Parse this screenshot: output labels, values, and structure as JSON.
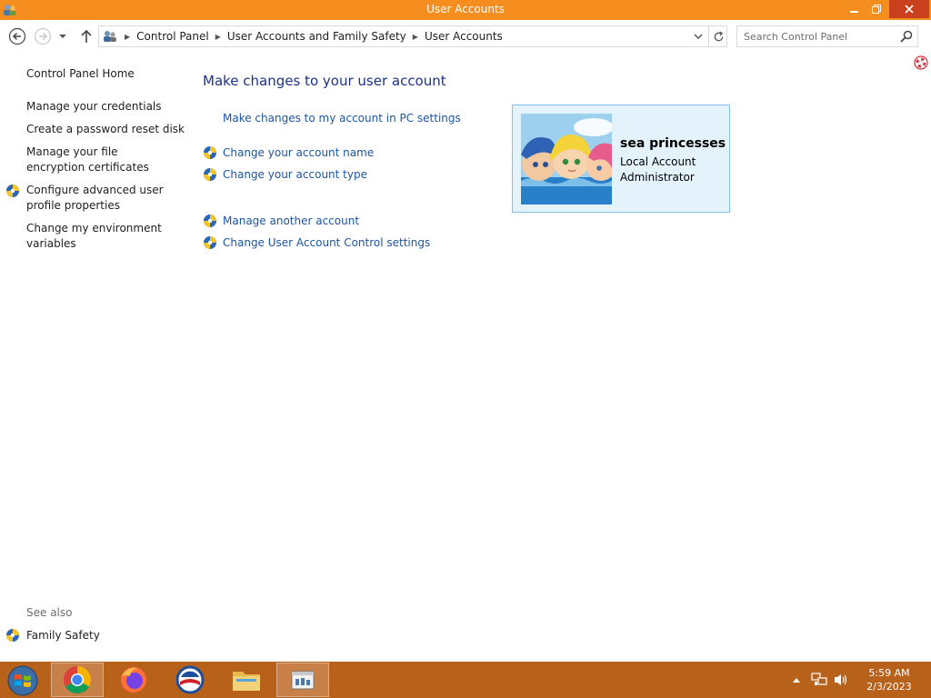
{
  "window": {
    "title": "User Accounts"
  },
  "address_bar": {
    "crumbs": [
      "Control Panel",
      "User Accounts and Family Safety",
      "User Accounts"
    ]
  },
  "search": {
    "placeholder": "Search Control Panel"
  },
  "left_pane": {
    "home": "Control Panel Home",
    "items": [
      "Manage your credentials",
      "Create a password reset disk",
      "Manage your file encryption certificates",
      "Configure advanced user profile properties",
      "Change my environment variables"
    ],
    "see_also_label": "See also",
    "see_also_items": [
      "Family Safety"
    ]
  },
  "main": {
    "heading": "Make changes to your user account",
    "pc_settings_link": "Make changes to my account in PC settings",
    "links": [
      "Change your account name",
      "Change your account type",
      "Manage another account",
      "Change User Account Control settings"
    ]
  },
  "account": {
    "name": "sea princesses",
    "type": "Local Account",
    "role": "Administrator"
  },
  "taskbar": {
    "apps": [
      "chrome-icon",
      "firefox-icon",
      "obama-logo-icon",
      "file-explorer-icon",
      "control-panel-icon"
    ],
    "time": "5:59 AM",
    "date": "2/3/2023"
  },
  "colors": {
    "titlebar": "#f58e1e",
    "taskbar": "#b8611b",
    "link": "#1e55a0",
    "heading": "#1e3287"
  }
}
